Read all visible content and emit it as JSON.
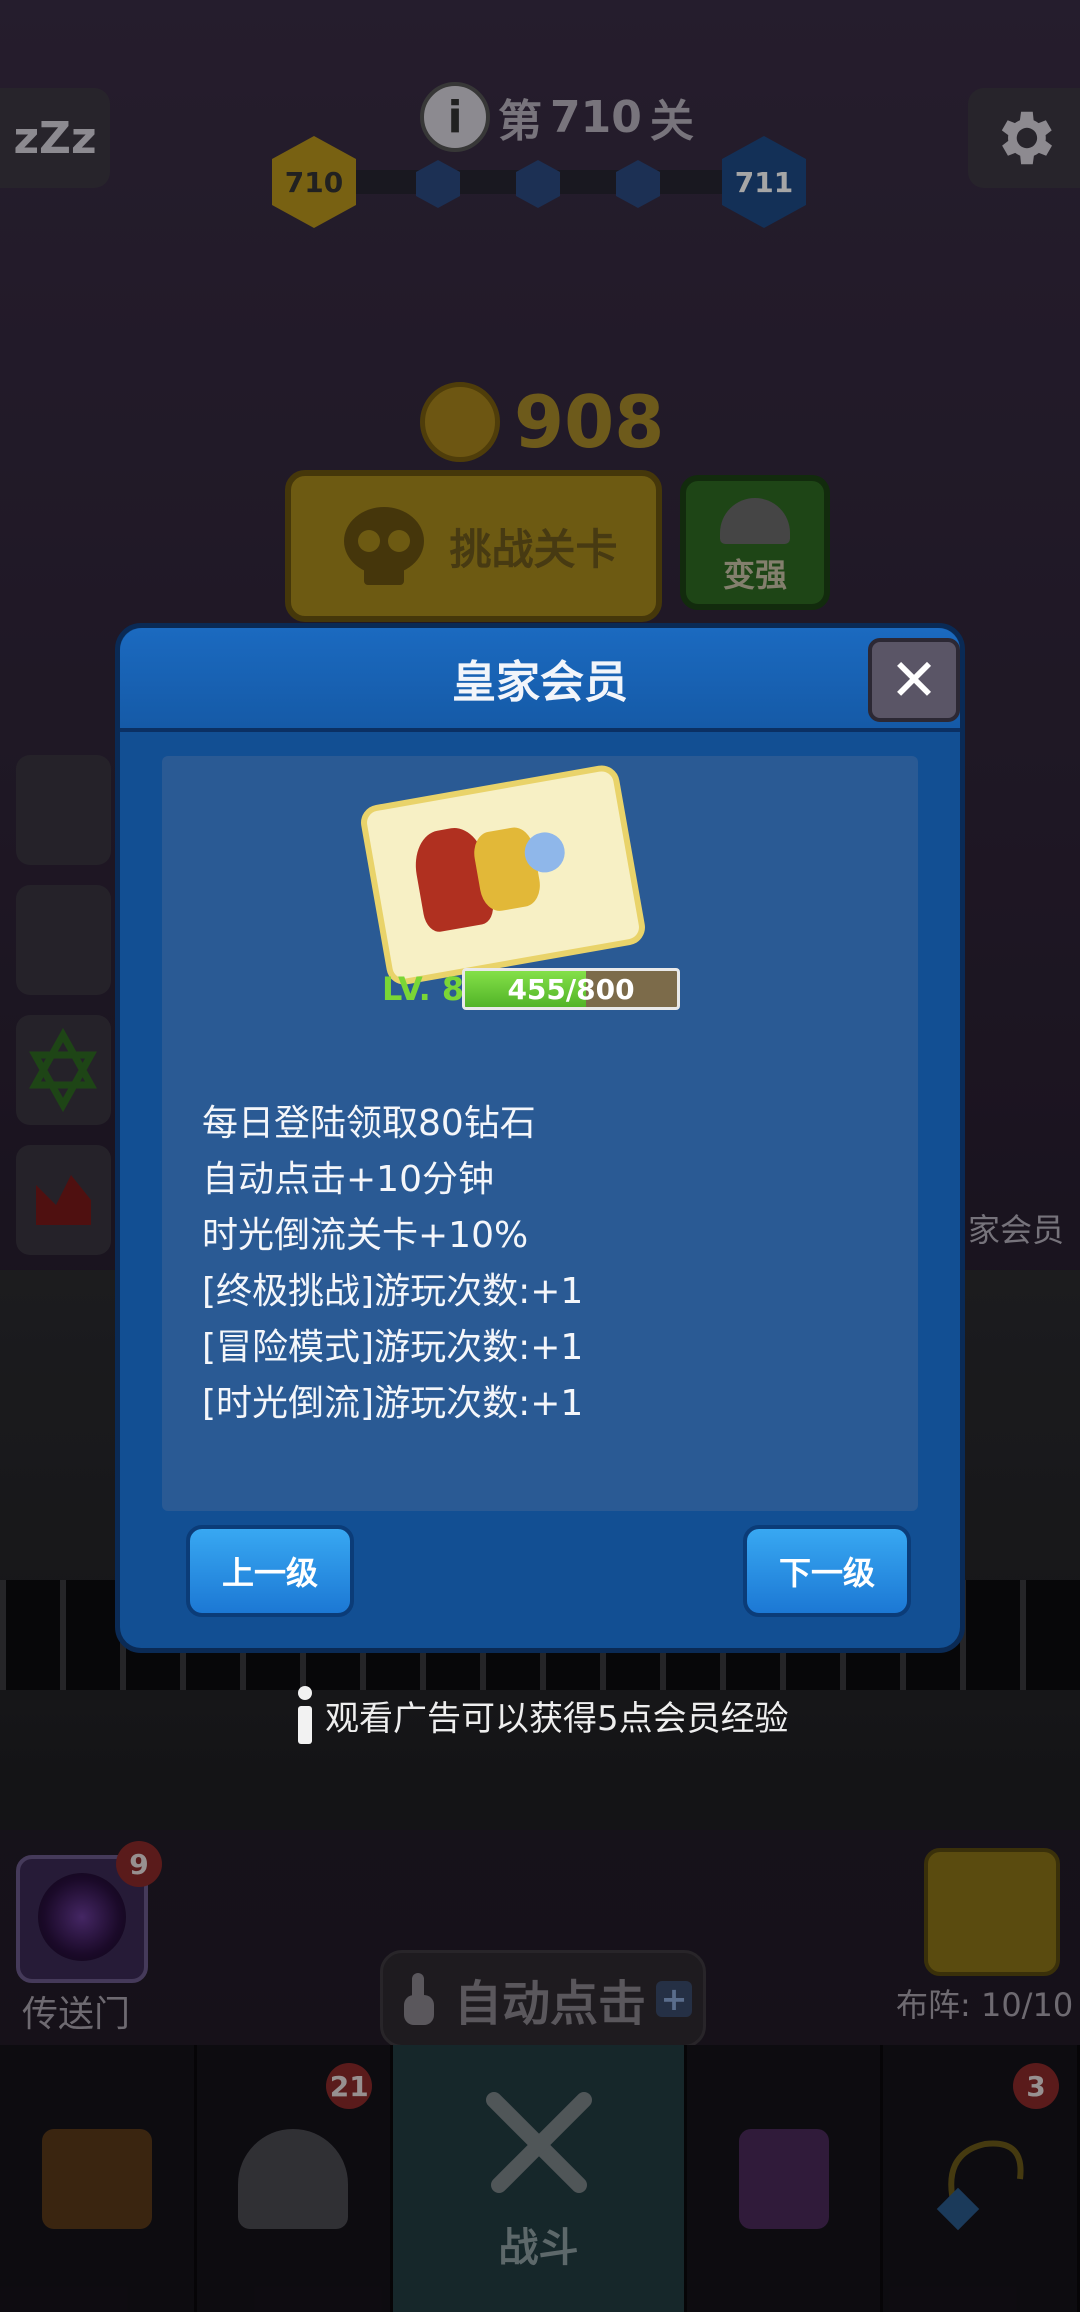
{
  "hud": {
    "zzz": "zZz",
    "level_title_prefix": "第",
    "level_number": "710",
    "level_title_suffix": "关",
    "hex_current": "710",
    "hex_next": "711",
    "coins": "908"
  },
  "buttons": {
    "challenge": "挑战关卡",
    "stronger": "变强"
  },
  "side": {
    "royal_label": "家会员"
  },
  "dialog": {
    "title": "皇家会员",
    "close": "✕",
    "level_label": "LV. 8",
    "exp_text": "455/800",
    "exp_current": 455,
    "exp_max": 800,
    "benefits": [
      "每日登陆领取80钻石",
      "自动点击+10分钟",
      "时光倒流关卡+10%",
      "[终极挑战]游玩次数:+1",
      "[冒险模式]游玩次数:+1",
      "[时光倒流]游玩次数:+1"
    ],
    "prev_button": "上一级",
    "next_button": "下一级"
  },
  "watch_ad": "观看广告可以获得5点会员经验",
  "bottom": {
    "portal_label": "传送门",
    "portal_badge": "9",
    "formation_label": "布阵: 10/10",
    "auto_click": "自动点击",
    "auto_click_plus": "+"
  },
  "nav": {
    "heroes_badge": "21",
    "battle_label": "战斗",
    "amulet_badge": "3"
  },
  "colors": {
    "dialog_bg": "#124f93",
    "dialog_header": "#1b6ac0",
    "button_blue": "#38a8f2",
    "level_green": "#7ad636",
    "exp_fill": "#52b428"
  }
}
